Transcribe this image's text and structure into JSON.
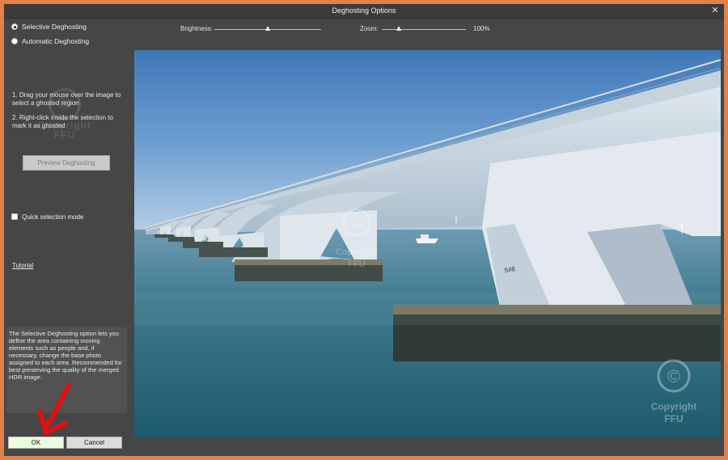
{
  "window": {
    "title": "Deghosting Options"
  },
  "mode": {
    "options": [
      {
        "label": "Selective Deghosting",
        "selected": true
      },
      {
        "label": "Automatic Deghosting",
        "selected": false
      }
    ]
  },
  "instructions": {
    "step1": "1. Drag your mouse over the image to select a ghosted region",
    "step2": "2. Right-click inside the selection to mark it as ghosted"
  },
  "preview_button": {
    "label": "Preview Deghosting",
    "enabled": false
  },
  "quick_selection": {
    "label": "Quick selection mode",
    "checked": false
  },
  "tutorial_link": "Tutorial",
  "description": "The Selective Deghosting option lets you define the area containing moving elements such as people and, if necessary, change the base photo assigned to each area. Recommended for best preserving the quality of the merged HDR image.",
  "buttons": {
    "ok": "OK",
    "cancel": "Cancel"
  },
  "brightness": {
    "label": "Brightness:",
    "value": 0.5
  },
  "zoom": {
    "label": "Zoom:",
    "value": 0.2,
    "value_text": "100%"
  },
  "watermark": {
    "symbol": "©",
    "line1": "Copyright",
    "line2": "FFU"
  },
  "photo": {
    "icon": "bridge-photo",
    "pier_number": "5#8"
  },
  "colors": {
    "frame": "#e0804c",
    "ok_button": "#eafddf",
    "annotation_arrow": "#e01010"
  }
}
